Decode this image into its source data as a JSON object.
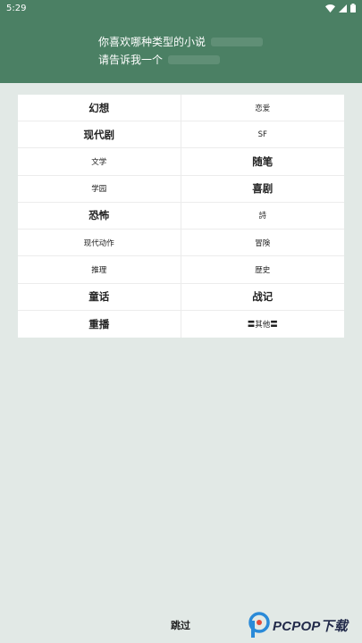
{
  "status_bar": {
    "time": "5:29"
  },
  "header": {
    "line1": "你喜欢哪种类型的小说",
    "line2": "请告诉我一个"
  },
  "genres": [
    {
      "left": "幻想",
      "right": "恋爱"
    },
    {
      "left": "现代剧",
      "right": "SF"
    },
    {
      "left": "文学",
      "right": "随笔"
    },
    {
      "left": "学园",
      "right": "喜剧"
    },
    {
      "left": "恐怖",
      "right": "詩"
    },
    {
      "left": "现代动作",
      "right": "冒険"
    },
    {
      "left": "推理",
      "right": "歴史"
    },
    {
      "left": "童话",
      "right": "战记"
    },
    {
      "left": "重播",
      "right": "〓其他〓"
    }
  ],
  "skip_label": "跳过",
  "watermark": {
    "text": "PCPOP下载"
  },
  "colors": {
    "header": "#4b8064",
    "background": "#e2e9e6",
    "panel": "#ffffff"
  }
}
